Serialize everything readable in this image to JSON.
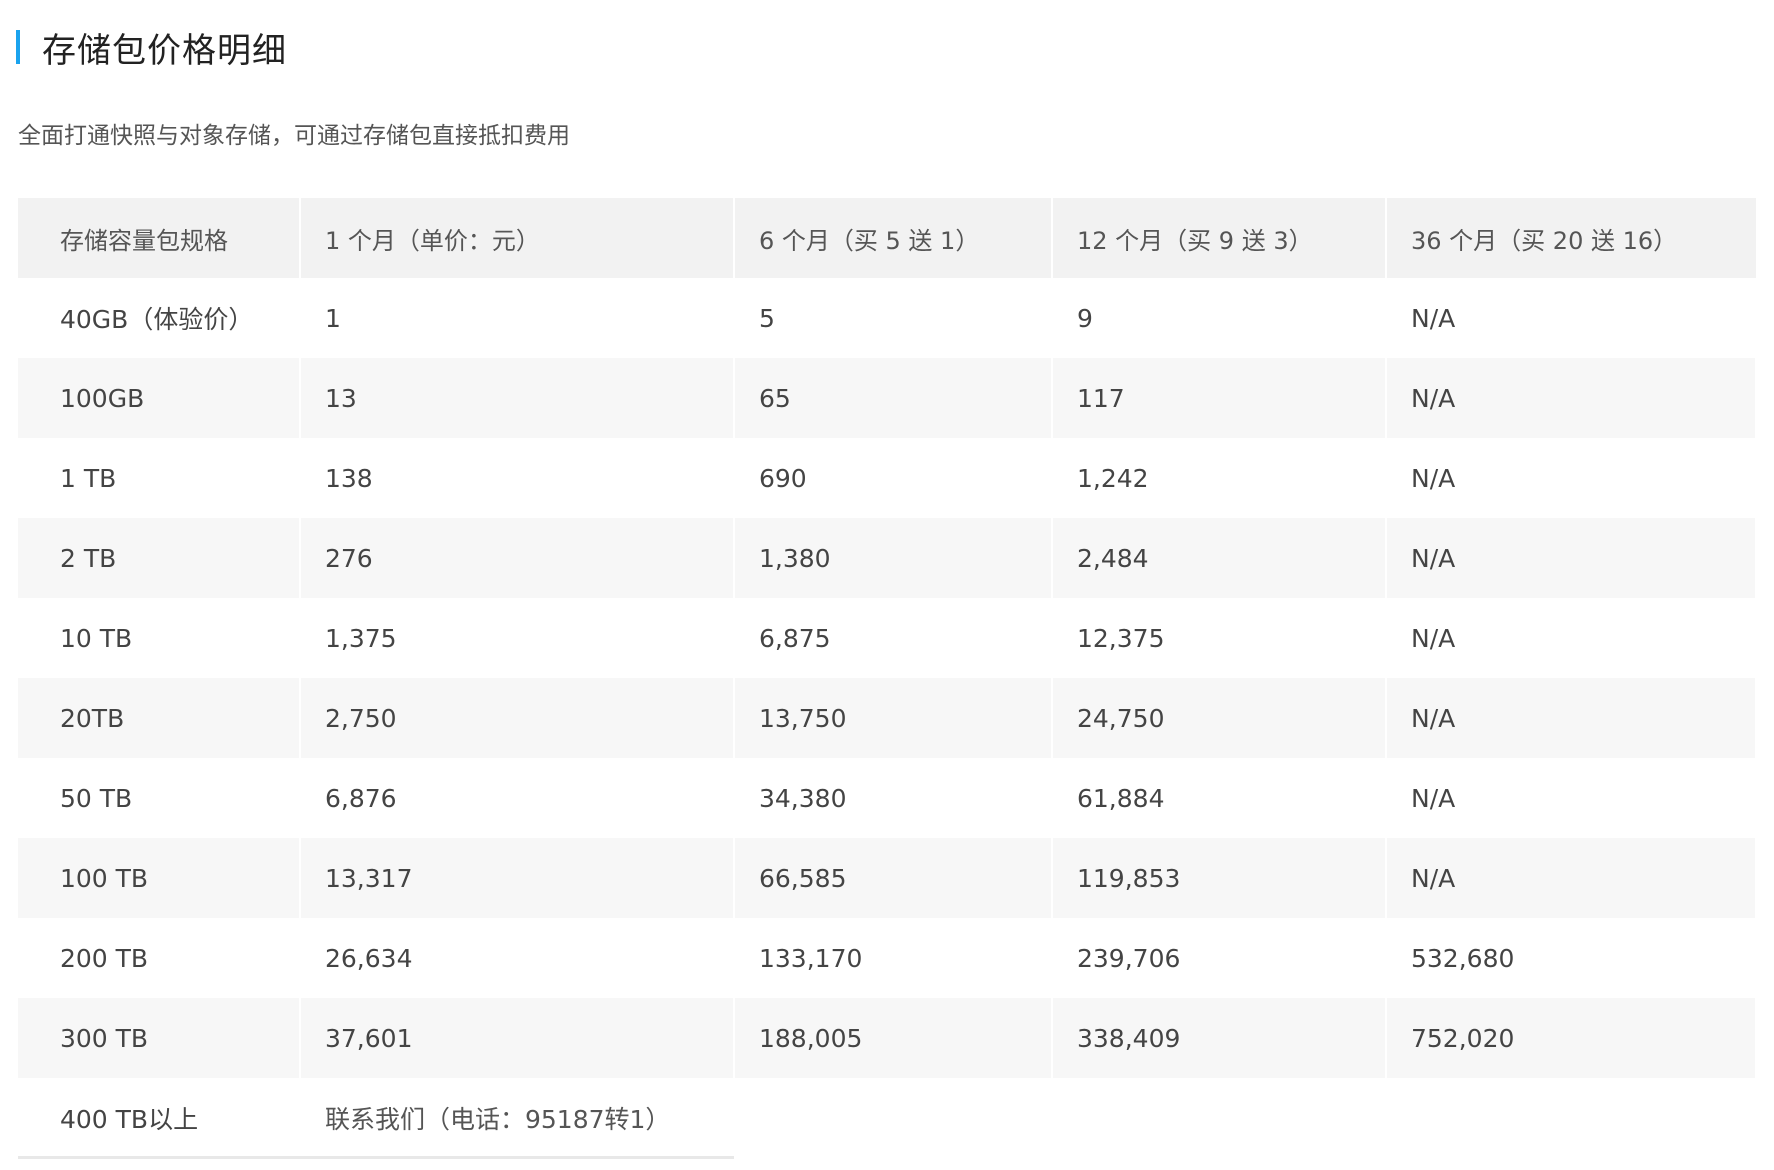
{
  "section": {
    "title": "存储包价格明细",
    "subtitle": "全面打通快照与对象存储，可通过存储包直接抵扣费用",
    "accent_color": "#1aa3ee"
  },
  "table": {
    "headers": [
      "存储容量包规格",
      "1 个月（单价：元）",
      "6 个月（买 5 送 1）",
      "12 个月（买 9 送 3）",
      "36 个月（买 20 送 16）"
    ],
    "rows": [
      [
        "40GB（体验价）",
        "1",
        "5",
        "9",
        "N/A"
      ],
      [
        "100GB",
        "13",
        "65",
        "117",
        "N/A"
      ],
      [
        "1 TB",
        "138",
        "690",
        "1,242",
        "N/A"
      ],
      [
        "2 TB",
        "276",
        "1,380",
        "2,484",
        "N/A"
      ],
      [
        "10 TB",
        "1,375",
        "6,875",
        "12,375",
        "N/A"
      ],
      [
        "20TB",
        "2,750",
        "13,750",
        "24,750",
        "N/A"
      ],
      [
        "50 TB",
        "6,876",
        "34,380",
        "61,884",
        "N/A"
      ],
      [
        "100 TB",
        "13,317",
        "66,585",
        "119,853",
        "N/A"
      ],
      [
        "200 TB",
        "26,634",
        "133,170",
        "239,706",
        "532,680"
      ],
      [
        "300 TB",
        "37,601",
        "188,005",
        "338,409",
        "752,020"
      ]
    ],
    "contact_row": {
      "spec": "400 TB以上",
      "text": "联系我们（电话：95187转1）"
    }
  }
}
